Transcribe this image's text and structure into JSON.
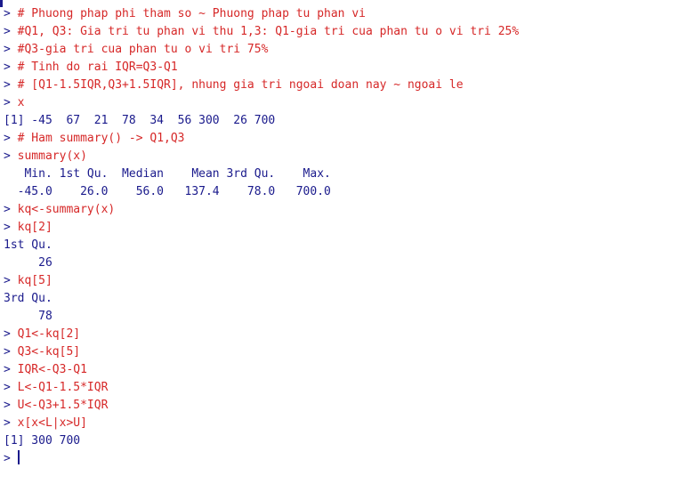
{
  "console": {
    "prompt": "> ",
    "lines": [
      {
        "type": "cmd",
        "text": "# Phuong phap phi tham so ~ Phuong phap tu phan vi"
      },
      {
        "type": "cmd",
        "text": "#Q1, Q3: Gia tri tu phan vi thu 1,3: Q1-gia tri cua phan tu o vi tri 25%"
      },
      {
        "type": "cmd",
        "text": "#Q3-gia tri cua phan tu o vi tri 75%"
      },
      {
        "type": "cmd",
        "text": "# Tinh do rai IQR=Q3-Q1"
      },
      {
        "type": "cmd",
        "text": "# [Q1-1.5IQR,Q3+1.5IQR], nhung gia tri ngoai doan nay ~ ngoai le"
      },
      {
        "type": "cmd",
        "text": "x"
      },
      {
        "type": "out",
        "text": "[1] -45  67  21  78  34  56 300  26 700"
      },
      {
        "type": "cmd",
        "text": "# Ham summary() -> Q1,Q3"
      },
      {
        "type": "cmd",
        "text": "summary(x)"
      },
      {
        "type": "out",
        "text": "   Min. 1st Qu.  Median    Mean 3rd Qu.    Max. "
      },
      {
        "type": "out",
        "text": "  -45.0    26.0    56.0   137.4    78.0   700.0 "
      },
      {
        "type": "cmd",
        "text": "kq<-summary(x)"
      },
      {
        "type": "cmd",
        "text": "kq[2]"
      },
      {
        "type": "out",
        "text": "1st Qu. "
      },
      {
        "type": "out",
        "text": "     26 "
      },
      {
        "type": "cmd",
        "text": "kq[5]"
      },
      {
        "type": "out",
        "text": "3rd Qu. "
      },
      {
        "type": "out",
        "text": "     78 "
      },
      {
        "type": "cmd",
        "text": "Q1<-kq[2]"
      },
      {
        "type": "cmd",
        "text": "Q3<-kq[5]"
      },
      {
        "type": "cmd",
        "text": "IQR<-Q3-Q1"
      },
      {
        "type": "cmd",
        "text": "L<-Q1-1.5*IQR"
      },
      {
        "type": "cmd",
        "text": "U<-Q3+1.5*IQR"
      },
      {
        "type": "cmd",
        "text": "x[x<L|x>U]"
      },
      {
        "type": "out",
        "text": "[1] 300 700"
      },
      {
        "type": "input",
        "text": ""
      }
    ]
  }
}
